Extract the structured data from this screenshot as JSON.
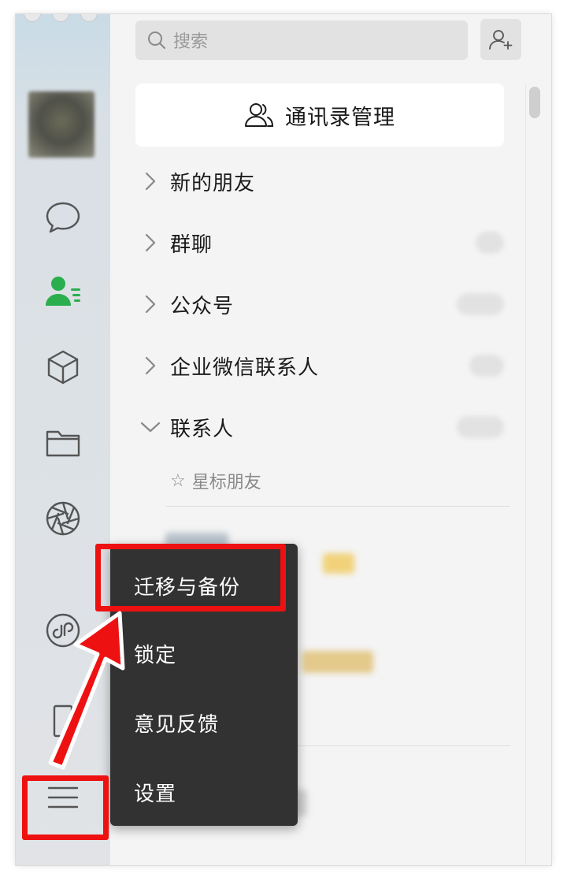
{
  "search": {
    "placeholder": "搜索"
  },
  "contacts": {
    "manage_label": "通讯录管理",
    "groups": [
      {
        "label": "新的朋友",
        "expanded": false
      },
      {
        "label": "群聊",
        "expanded": false
      },
      {
        "label": "公众号",
        "expanded": false
      },
      {
        "label": "企业微信联系人",
        "expanded": false
      },
      {
        "label": "联系人",
        "expanded": true
      }
    ],
    "starred_label": "星标朋友"
  },
  "menu": {
    "items": [
      {
        "label": "迁移与备份"
      },
      {
        "label": "锁定"
      },
      {
        "label": "意见反馈"
      },
      {
        "label": "设置"
      }
    ]
  },
  "colors": {
    "accent_green": "#2bae4e",
    "highlight_red": "#ee1111",
    "menu_bg": "#323232"
  },
  "icons": {
    "rail": [
      "chat-icon",
      "contacts-icon",
      "favorites-icon",
      "files-icon",
      "moments-icon",
      "mini-program-icon",
      "phone-icon",
      "menu-icon"
    ]
  }
}
